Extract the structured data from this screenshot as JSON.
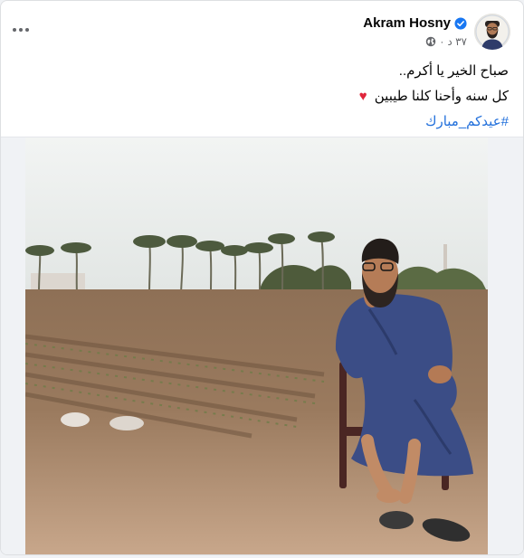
{
  "post": {
    "author": "Akram Hosny",
    "time": "٣٧ د",
    "text_line1": "صباح الخير يا أكرم..",
    "text_line2": "كل سنه وأحنا كلنا طيبين",
    "hashtag": "#عيدكم_مبارك"
  },
  "icons": {
    "more": "more-horizontal-icon",
    "verified": "verified-badge-icon",
    "audience": "globe-icon",
    "heart": "red-heart-icon"
  },
  "colors": {
    "link": "#216fdb",
    "verified": "#1877f2",
    "heart": "#e0253b"
  }
}
